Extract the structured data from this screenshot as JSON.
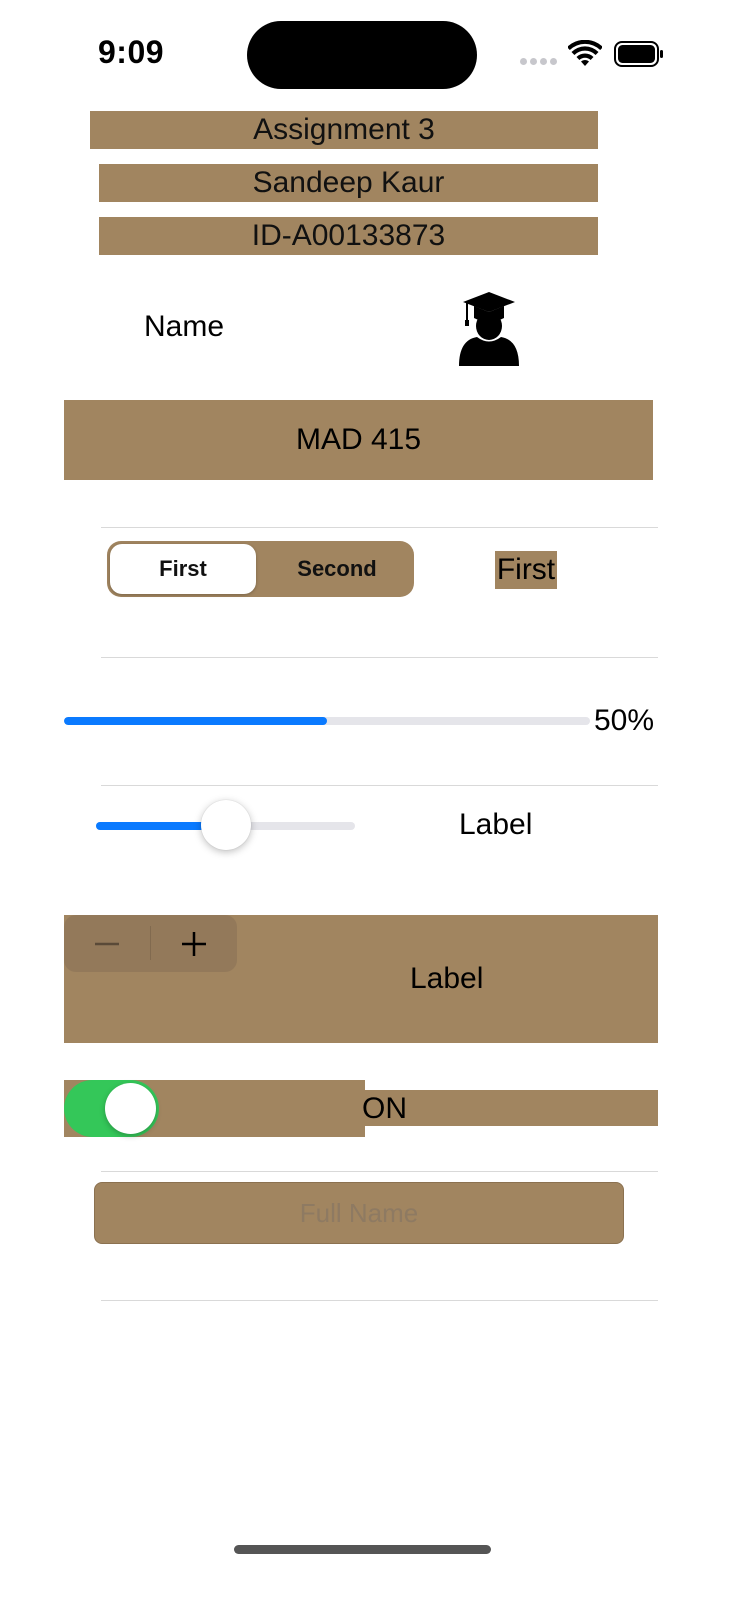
{
  "status_bar": {
    "time": "9:09",
    "icons": [
      "signal-dots-icon",
      "wifi-icon",
      "battery-icon"
    ]
  },
  "header": {
    "assignment": "Assignment 3",
    "student_name": "Sandeep  Kaur",
    "student_id": "ID-A00133873"
  },
  "profile": {
    "name_label": "Name",
    "icon": "graduate-icon"
  },
  "course": {
    "label": "MAD 415"
  },
  "segmented": {
    "options": [
      "First",
      "Second"
    ],
    "selected_index": 0,
    "result_label": "First"
  },
  "progress": {
    "value": 0.5,
    "label": "50%"
  },
  "slider": {
    "value": 0.5,
    "label": "Label"
  },
  "stepper": {
    "minus": "−",
    "plus": "+",
    "label": "Label"
  },
  "toggle": {
    "on": true,
    "label": "ON"
  },
  "text_field": {
    "value": "",
    "placeholder": "Full Name"
  },
  "colors": {
    "accent_tan": "#a18560",
    "progress_blue": "#0a7aff",
    "switch_green": "#34c759"
  }
}
